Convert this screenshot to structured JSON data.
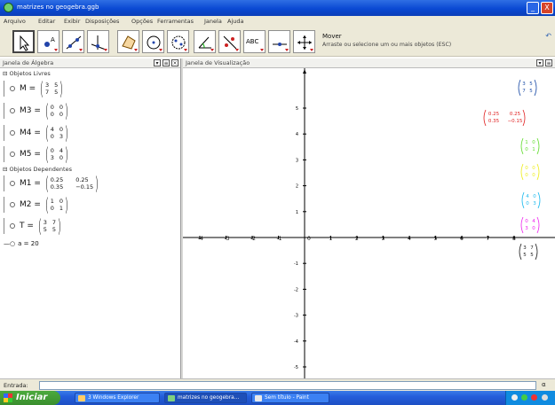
{
  "window": {
    "title": "matrizes no geogebra.ggb",
    "min": "_",
    "close": "X"
  },
  "menu": [
    "Arquivo",
    "Editar",
    "Exibir",
    "Disposições",
    "Opções",
    "Ferramentas",
    "Janela",
    "Ajuda"
  ],
  "toolbar": {
    "mode_name": "Mover",
    "mode_help": "Arraste ou selecione um ou mais objetos (ESC)",
    "text_tool": "ABC"
  },
  "algebra": {
    "header": "Janela de Álgebra",
    "free_group": "Objetos Livres",
    "dependent_group": "Objetos Dependentes",
    "free": [
      {
        "name": "M",
        "eq": "=",
        "m": [
          "3",
          "5",
          "7",
          "5"
        ]
      },
      {
        "name": "M3",
        "eq": "=",
        "m": [
          "0",
          "0",
          "0",
          "0"
        ]
      },
      {
        "name": "M4",
        "eq": "=",
        "m": [
          "4",
          "0",
          "0",
          "3"
        ]
      },
      {
        "name": "M5",
        "eq": "=",
        "m": [
          "0",
          "4",
          "3",
          "0"
        ]
      }
    ],
    "dependent": [
      {
        "name": "M1",
        "eq": "=",
        "m": [
          "0.25",
          "0.25",
          "0.35",
          "−0.15"
        ]
      },
      {
        "name": "M2",
        "eq": "=",
        "m": [
          "1",
          "0",
          "0",
          "1"
        ]
      },
      {
        "name": "T",
        "eq": "=",
        "m": [
          "3",
          "7",
          "5",
          "5"
        ]
      }
    ],
    "number": {
      "name": "a",
      "eq": "=",
      "value": "20"
    }
  },
  "graphics": {
    "header": "Janela de Visualização",
    "x_ticks": [
      "-4",
      "-3",
      "-2",
      "-1",
      "0",
      "1",
      "2",
      "3",
      "4",
      "5",
      "6",
      "7",
      "8"
    ],
    "y_ticks": [
      "5",
      "4",
      "3",
      "2",
      "1",
      "-1",
      "-2",
      "-3",
      "-4",
      "-5"
    ],
    "matrices": [
      {
        "m": [
          "3",
          "5",
          "7",
          "5"
        ],
        "color": "#1f4fa8"
      },
      {
        "m": [
          "0.25",
          "0.25",
          "0.35",
          "−0.15"
        ],
        "color": "#e02020"
      },
      {
        "m": [
          "1",
          "0",
          "0",
          "1"
        ],
        "color": "#66dd33"
      },
      {
        "m": [
          "0",
          "0",
          "0",
          "0"
        ],
        "color": "#eeee22"
      },
      {
        "m": [
          "4",
          "0",
          "0",
          "3"
        ],
        "color": "#22bbee"
      },
      {
        "m": [
          "0",
          "4",
          "3",
          "0"
        ],
        "color": "#ee22ee"
      },
      {
        "m": [
          "3",
          "7",
          "5",
          "5"
        ],
        "color": "#222222"
      }
    ]
  },
  "input": {
    "label": "Entrada:",
    "value": "",
    "alpha": "α"
  },
  "taskbar": {
    "start": "Iniciar",
    "tasks": [
      "3 Windows Explorer",
      "matrizes no geogebra...",
      "Sem título - Paint"
    ]
  }
}
